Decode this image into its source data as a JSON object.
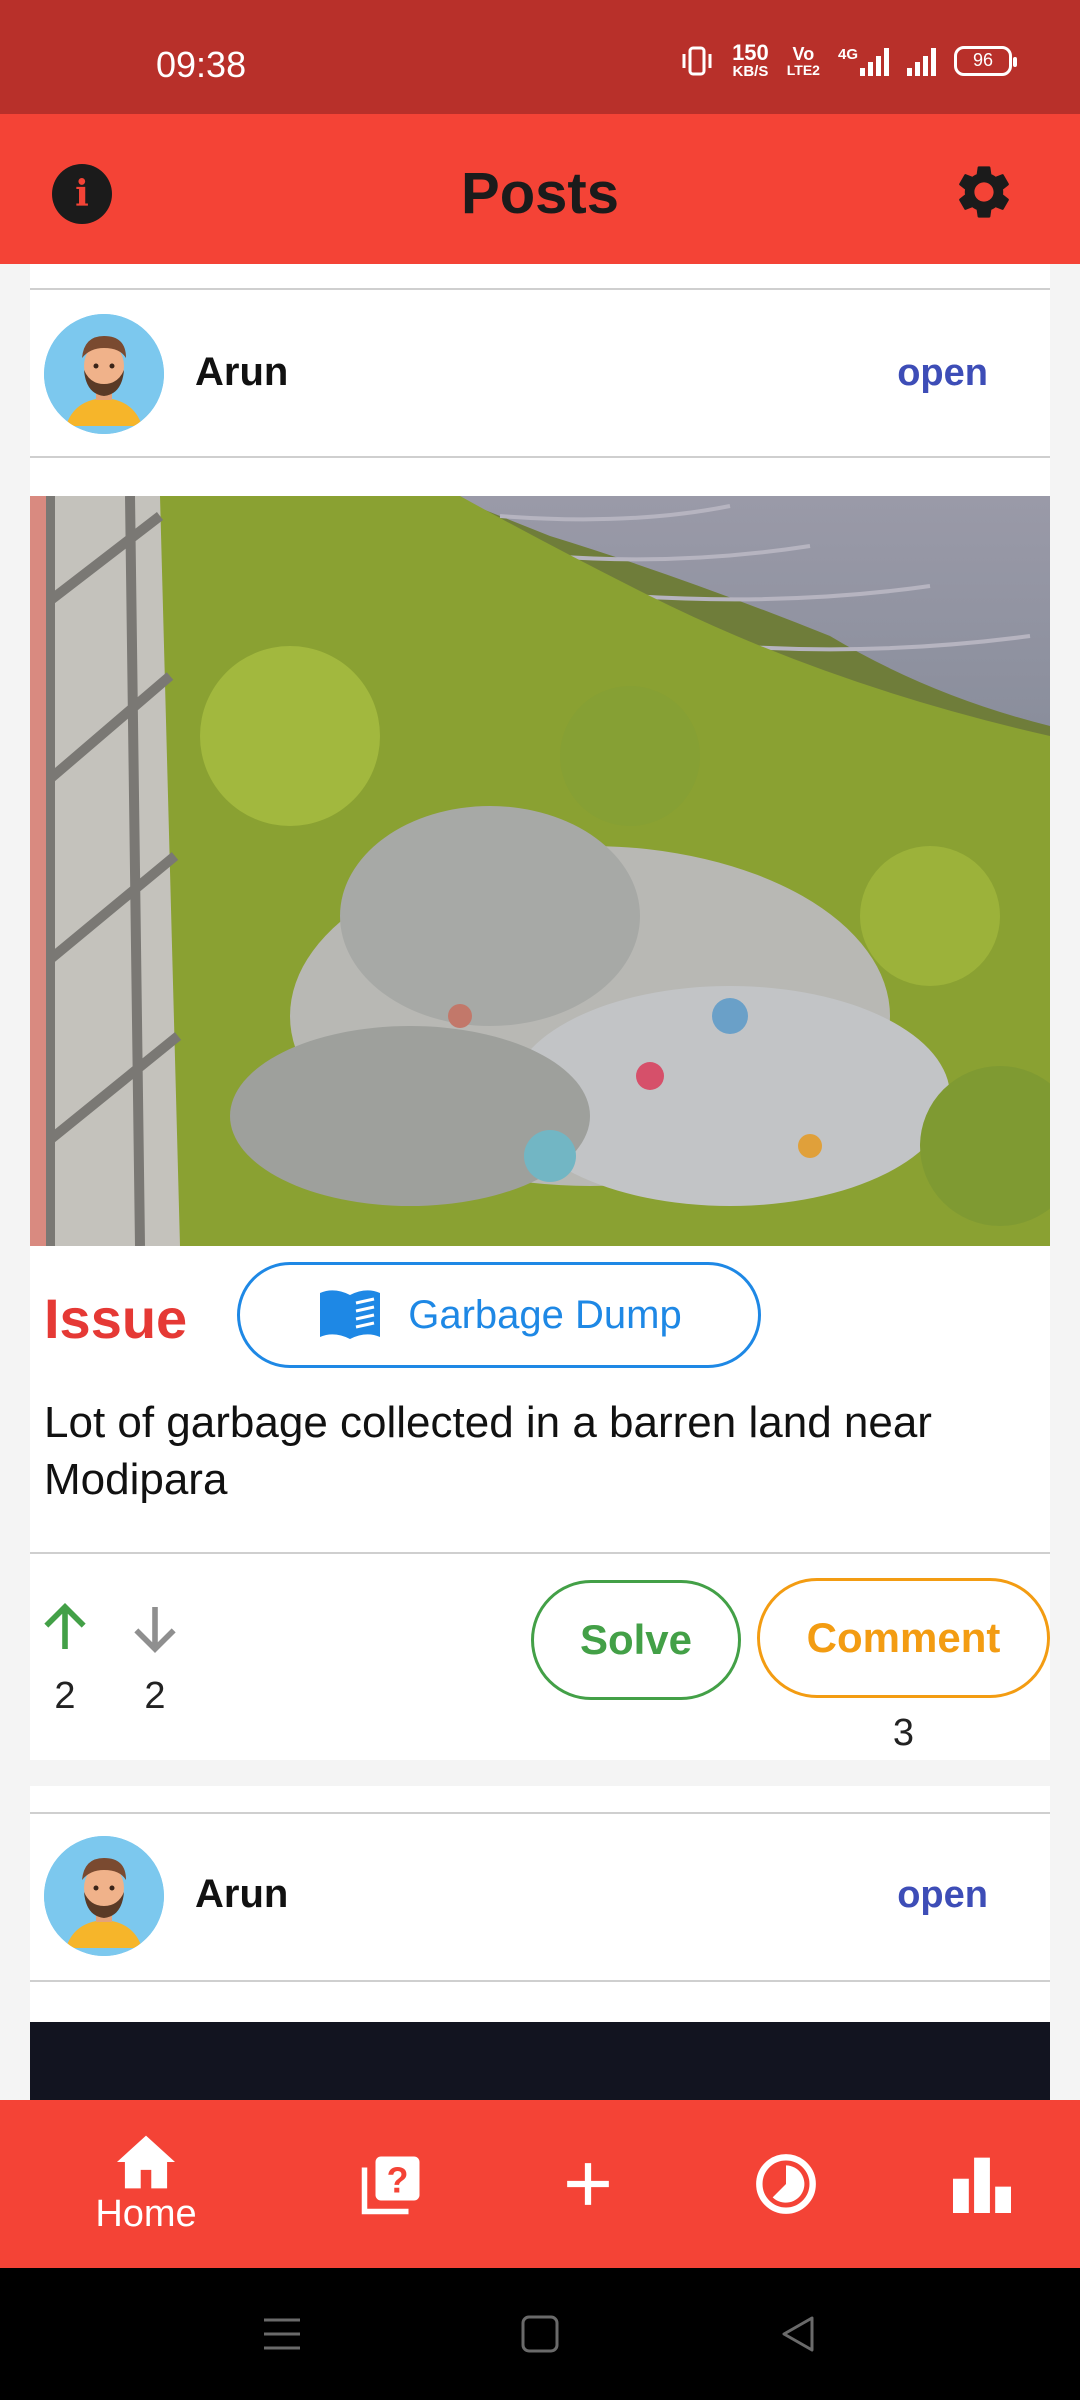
{
  "status_bar": {
    "time": "09:38",
    "net_speed_value": "150",
    "net_speed_unit": "KB/S",
    "volte_line1": "Vo",
    "volte_line2": "LTE2",
    "network_type": "4G",
    "battery": "96"
  },
  "app_bar": {
    "title": "Posts",
    "info_icon": "info-icon",
    "settings_icon": "gear-icon"
  },
  "posts": [
    {
      "user": "Arun",
      "status": "open",
      "type_label": "Issue",
      "category": "Garbage Dump",
      "category_icon": "book-icon",
      "description": "Lot of garbage collected in a barren land near Modipara",
      "upvotes": "2",
      "downvotes": "2",
      "solve_label": "Solve",
      "comment_label": "Comment",
      "comment_count": "3"
    },
    {
      "user": "Arun",
      "status": "open"
    }
  ],
  "bottom_nav": {
    "home_label": "Home",
    "items": [
      "home-icon",
      "question-icon",
      "plus-icon",
      "timer-icon",
      "bar-chart-icon"
    ]
  },
  "colors": {
    "status_bar": "#b8302a",
    "primary": "#f44336",
    "issue_red": "#e53935",
    "chip_blue": "#1e88e5",
    "open_blue": "#3d4db7",
    "solve_green": "#43a047",
    "comment_orange": "#f39c12"
  }
}
